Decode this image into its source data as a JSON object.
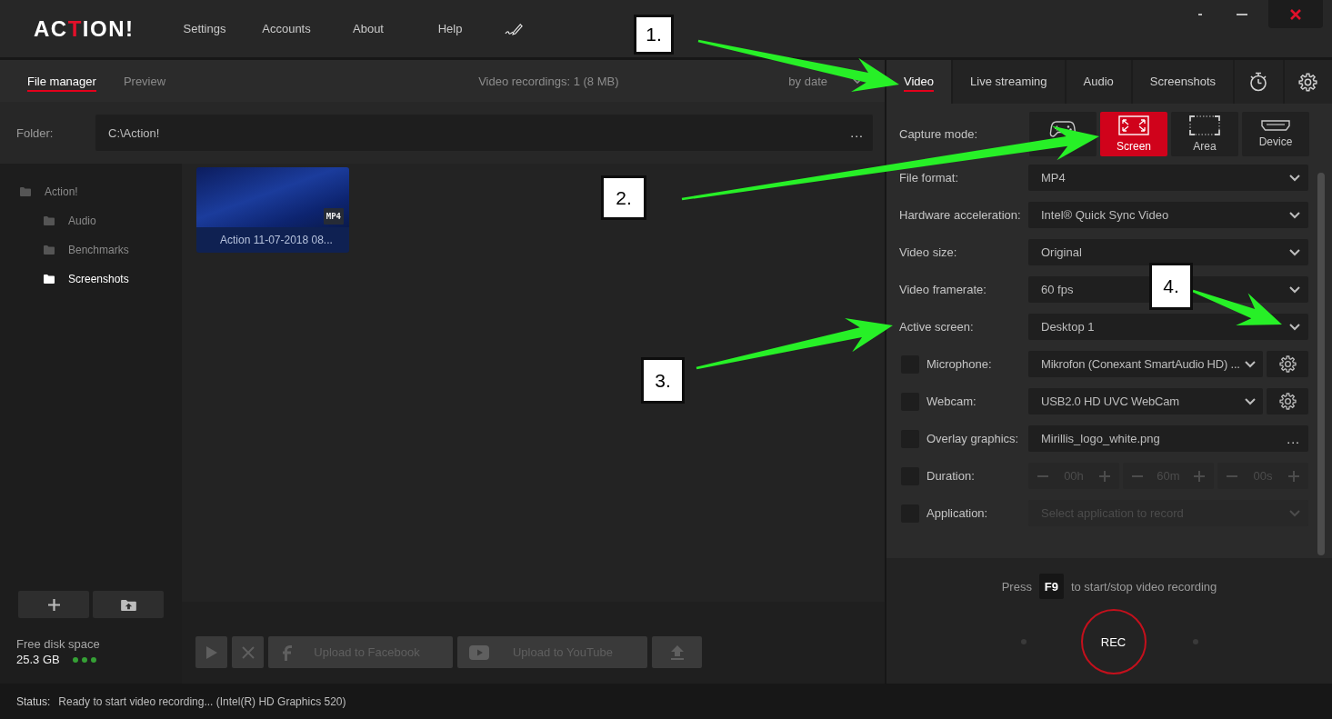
{
  "window": {
    "logo": [
      {
        "text": "AC",
        "accent": false
      },
      {
        "text": "T",
        "accent": true
      },
      {
        "text": "ION!",
        "accent": false
      }
    ],
    "menu": [
      "Settings",
      "Accounts",
      "About",
      "Help"
    ]
  },
  "file_manager": {
    "tabs": [
      {
        "label": "File manager",
        "selected": true
      },
      {
        "label": "Preview",
        "selected": false
      }
    ],
    "summary": "Video recordings: 1 (8 MB)",
    "sort": "by date",
    "folder": {
      "label": "Folder:",
      "value": "C:\\Action!",
      "browse": "..."
    },
    "tree": [
      {
        "label": "Action!",
        "selected": false,
        "children": [
          {
            "label": "Audio",
            "selected": false
          },
          {
            "label": "Benchmarks",
            "selected": false
          },
          {
            "label": "Screenshots",
            "selected": true
          }
        ]
      }
    ],
    "disk": {
      "label": "Free disk space",
      "value": "25.3 GB"
    },
    "files": [
      {
        "name": "Action 11-07-2018 08...",
        "format": "MP4"
      }
    ],
    "actions": [
      {
        "kind": "play",
        "disabled": true
      },
      {
        "kind": "delete",
        "disabled": true
      },
      {
        "kind": "facebook",
        "label": "Upload to Facebook",
        "disabled": true
      },
      {
        "kind": "youtube",
        "label": "Upload to YouTube",
        "disabled": true
      },
      {
        "kind": "upload",
        "disabled": true
      }
    ]
  },
  "video_panel": {
    "tabs": [
      {
        "kind": "text",
        "label": "Video",
        "selected": true
      },
      {
        "kind": "text",
        "label": "Live streaming",
        "selected": false
      },
      {
        "kind": "text",
        "label": "Audio",
        "selected": false
      },
      {
        "kind": "text",
        "label": "Screenshots",
        "selected": false
      },
      {
        "kind": "timer",
        "selected": false
      },
      {
        "kind": "settings",
        "selected": false
      }
    ],
    "capture_mode": {
      "label": "Capture mode:",
      "modes": [
        {
          "kind": "game",
          "selected": false
        },
        {
          "kind": "screen",
          "label": "Screen",
          "selected": true
        },
        {
          "kind": "area",
          "label": "Area",
          "selected": false
        },
        {
          "kind": "device",
          "label": "Device",
          "selected": false
        }
      ]
    },
    "rows": [
      {
        "kind": "dropdown",
        "label": "File format:",
        "value": "MP4",
        "disabled": false
      },
      {
        "kind": "dropdown",
        "label": "Hardware acceleration:",
        "value": "Intel® Quick Sync Video",
        "disabled": false
      },
      {
        "kind": "dropdown",
        "label": "Video size:",
        "value": "Original",
        "disabled": false
      },
      {
        "kind": "dropdown",
        "label": "Video framerate:",
        "value": "60 fps",
        "disabled": false
      },
      {
        "kind": "dropdown",
        "label": "Active screen:",
        "value": "Desktop 1",
        "disabled": false
      },
      {
        "kind": "device",
        "label": "Microphone:",
        "checked": false,
        "value": "Mikrofon (Conexant SmartAudio HD) ...",
        "disabled": false
      },
      {
        "kind": "device",
        "label": "Webcam:",
        "checked": false,
        "value": "USB2.0 HD UVC WebCam",
        "disabled": false
      },
      {
        "kind": "file",
        "label": "Overlay graphics:",
        "checked": false,
        "value": "Mirillis_logo_white.png",
        "browse": "...",
        "disabled": false
      },
      {
        "kind": "duration",
        "label": "Duration:",
        "checked": false,
        "disabled": true,
        "fields": [
          "00h",
          "60m",
          "00s"
        ]
      },
      {
        "kind": "application",
        "label": "Application:",
        "checked": false,
        "disabled": true,
        "placeholder": "Select application to record"
      }
    ],
    "hotkey": {
      "before": "Press",
      "key": "F9",
      "after": "to start/stop video recording"
    },
    "record": "REC"
  },
  "status_bar": {
    "label": "Status:",
    "text": "Ready to start video recording... (Intel(R) HD Graphics 520)"
  },
  "annotations": [
    {
      "label": "1."
    },
    {
      "label": "2."
    },
    {
      "label": "3."
    },
    {
      "label": "4."
    }
  ]
}
